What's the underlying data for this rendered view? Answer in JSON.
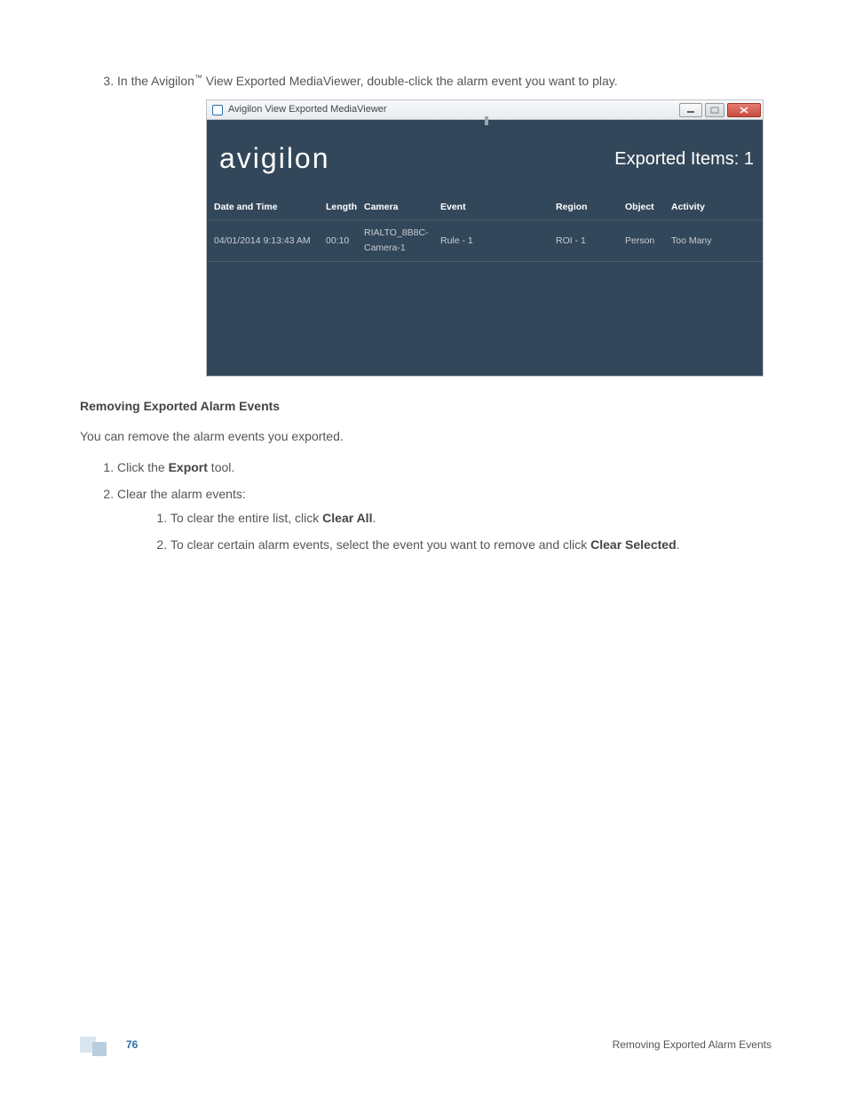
{
  "step3_prefix": "In the Avigilon",
  "step3_tm": "™",
  "step3_rest": " View Exported MediaViewer, double-click the alarm event you want to play.",
  "window_title": "Avigilon View Exported MediaViewer",
  "brand": "avigilon",
  "exported_label": "Exported Items: 1",
  "columns": {
    "date": "Date and Time",
    "length": "Length",
    "camera": "Camera",
    "event": "Event",
    "region": "Region",
    "object": "Object",
    "activity": "Activity"
  },
  "rows": [
    {
      "date": "04/01/2014 9:13:43 AM",
      "length": "00:10",
      "camera": "RIALTO_8B8C-Camera-1",
      "event": "Rule - 1",
      "region": "ROI - 1",
      "object": "Person",
      "activity": "Too Many"
    }
  ],
  "section_heading": "Removing Exported Alarm Events",
  "section_intro": "You can remove the alarm events you exported.",
  "li1_a": "Click the ",
  "li1_b": "Export",
  "li1_c": " tool.",
  "li2": "Clear the alarm events:",
  "li2_1_a": "To clear the entire list, click ",
  "li2_1_b": "Clear All",
  "li2_1_c": ".",
  "li2_2_a": "To clear certain alarm events, select the event you want to remove and click ",
  "li2_2_b": "Clear Selected",
  "li2_2_c": ".",
  "page_number": "76",
  "footer_right": "Removing Exported Alarm Events"
}
